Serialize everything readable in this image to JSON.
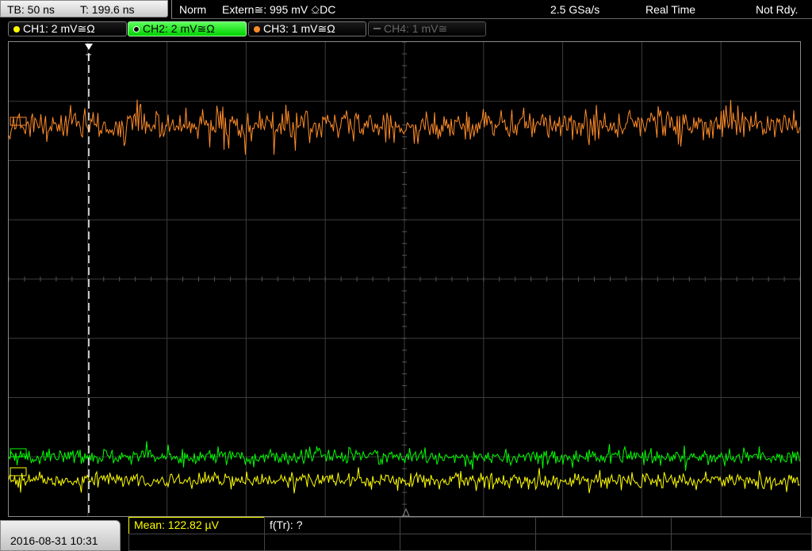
{
  "header": {
    "timebase": "TB: 50 ns",
    "trigger_time": "T: 199.6 ns",
    "trigger_mode": "Norm",
    "trigger_source": "Extern≅: 995 mV ⎐DC",
    "sample_rate": "2.5 GSa/s",
    "acq_mode": "Real Time",
    "status": "Not Rdy."
  },
  "channels": [
    {
      "label": "CH1: 2 mV≅Ω",
      "color": "#ffff00",
      "state": "active"
    },
    {
      "label": "CH2: 2 mV≅Ω",
      "color": "#00ff00",
      "state": "selected"
    },
    {
      "label": "CH3: 1 mV≅Ω",
      "color": "#ff8c28",
      "state": "active"
    },
    {
      "label": "CH4: 1 mV≅",
      "color": "#666666",
      "state": "off"
    }
  ],
  "measurements": {
    "mean": "Mean: 122.82 µV",
    "freq": "f(Tr): ?"
  },
  "footer": {
    "datetime": "2016-08-31 10:31"
  },
  "markers": {
    "trigger_marker": "T"
  },
  "colors": {
    "grid": "#3c3c3c",
    "ch1": "#ffff00",
    "ch2": "#00ff00",
    "ch3": "#ff8c28"
  },
  "waveforms": {
    "ch1_level_div": -3.4,
    "ch2_level_div": -3.0,
    "ch3_level_div": 2.6
  }
}
